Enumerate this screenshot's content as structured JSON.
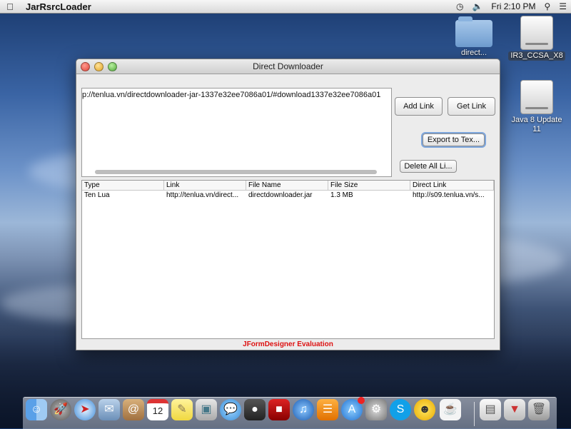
{
  "menubar": {
    "apple_icon": "apple-icon",
    "app_name": "JarRsrcLoader",
    "status_icons": [
      "time-machine-icon",
      "volume-icon",
      "search-icon",
      "list-icon"
    ],
    "clock": "Fri 2:10 PM"
  },
  "desktop": {
    "folder_label": "direct...",
    "drive1_label": "IR3_CCSA_X8",
    "drive2_label": "Java 8 Update 11"
  },
  "window": {
    "title": "Direct Downloader",
    "link_text": "p://tenlua.vn/directdownloader-jar-1337e32ee7086a01/#download1337e32ee7086a01",
    "buttons": {
      "add_link": "Add Link",
      "get_link": "Get Link",
      "export": "Export to Tex...",
      "delete_all": "Delete All Li..."
    },
    "table": {
      "columns": [
        "Type",
        "Link",
        "File Name",
        "File Size",
        "Direct Link"
      ],
      "rows": [
        [
          "Ten Lua",
          "http://tenlua.vn/direct...",
          "directdownloader.jar",
          "1.3 MB",
          "http://s09.tenlua.vn/s..."
        ]
      ]
    },
    "footer": "JFormDesigner Evaluation"
  },
  "dock": {
    "items": [
      "finder-icon",
      "launchpad-icon",
      "safari-icon",
      "mail-icon",
      "contacts-icon",
      "calendar-icon",
      "notes-icon",
      "preview-icon",
      "messages-icon",
      "facetime-icon",
      "photobooth-icon",
      "itunes-icon",
      "ibooks-icon",
      "appstore-icon",
      "system-preferences-icon",
      "skype-icon",
      "adium-icon",
      "java-icon",
      "documents-icon",
      "downloads-icon",
      "trash-icon"
    ],
    "calendar_day": "12"
  }
}
